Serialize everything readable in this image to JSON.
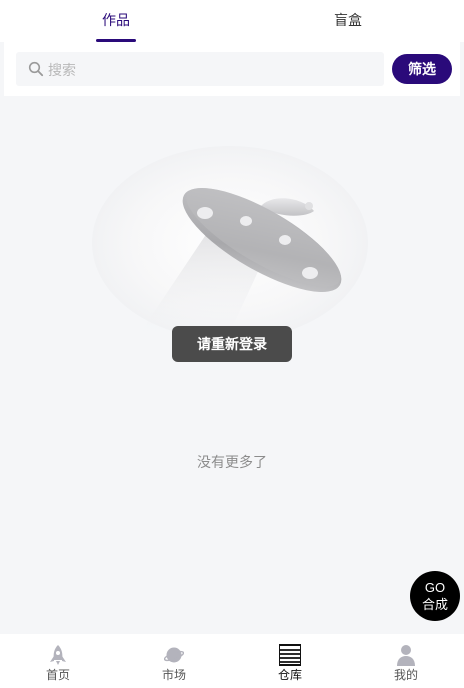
{
  "tabs": [
    {
      "label": "作品",
      "active": true
    },
    {
      "label": "盲盒",
      "active": false
    }
  ],
  "search": {
    "placeholder": "搜索",
    "value": ""
  },
  "filter": {
    "label": "筛选"
  },
  "empty": {
    "toast": "请重新登录",
    "no_more": "没有更多了"
  },
  "go": {
    "line1": "GO",
    "line2": "合成"
  },
  "nav": [
    {
      "label": "首页",
      "icon": "rocket-icon"
    },
    {
      "label": "市场",
      "icon": "planet-icon"
    },
    {
      "label": "仓库",
      "icon": "warehouse-icon",
      "active": true
    },
    {
      "label": "我的",
      "icon": "user-icon"
    }
  ],
  "colors": {
    "accent": "#2a0a7a",
    "toast_bg": "#4b4b4b",
    "page_bg": "#f5f6f8"
  }
}
